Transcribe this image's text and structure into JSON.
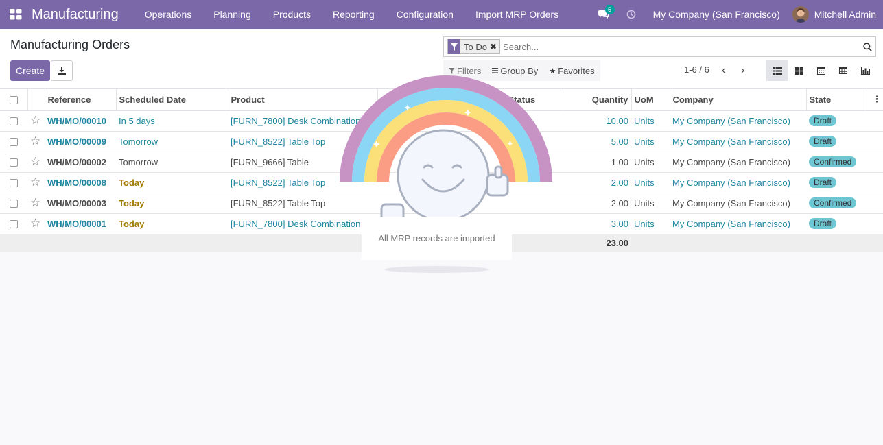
{
  "navbar": {
    "app_name": "Manufacturing",
    "menu": [
      "Operations",
      "Planning",
      "Products",
      "Reporting",
      "Configuration",
      "Import MRP Orders"
    ],
    "messages_count": "5",
    "company": "My Company (San Francisco)",
    "user": "Mitchell Admin",
    "color": "#7b68a8"
  },
  "control_panel": {
    "title": "Manufacturing Orders",
    "create_label": "Create",
    "search": {
      "facet": "To Do",
      "placeholder": "Search..."
    },
    "filters_label": "Filters",
    "group_by_label": "Group By",
    "favorites_label": "Favorites",
    "pager": "1-6 / 6"
  },
  "table": {
    "columns": [
      "Reference",
      "Scheduled Date",
      "Product",
      "Status",
      "Quantity",
      "UoM",
      "Company",
      "State"
    ],
    "rows": [
      {
        "reference": "WH/MO/00010",
        "date": "In 5 days",
        "product": "[FURN_7800] Desk Combination",
        "quantity": "10.00",
        "uom": "Units",
        "company": "My Company (San Francisco)",
        "state": "Draft"
      },
      {
        "reference": "WH/MO/00009",
        "date": "Tomorrow",
        "product": "[FURN_8522] Table Top",
        "quantity": "5.00",
        "uom": "Units",
        "company": "My Company (San Francisco)",
        "state": "Draft"
      },
      {
        "reference": "WH/MO/00002",
        "date": "Tomorrow",
        "product": "[FURN_9666] Table",
        "quantity": "1.00",
        "uom": "Units",
        "company": "My Company (San Francisco)",
        "state": "Confirmed"
      },
      {
        "reference": "WH/MO/00008",
        "date": "Today",
        "product": "[FURN_8522] Table Top",
        "quantity": "2.00",
        "uom": "Units",
        "company": "My Company (San Francisco)",
        "state": "Draft"
      },
      {
        "reference": "WH/MO/00003",
        "date": "Today",
        "product": "[FURN_8522] Table Top",
        "quantity": "2.00",
        "uom": "Units",
        "company": "My Company (San Francisco)",
        "state": "Confirmed"
      },
      {
        "reference": "WH/MO/00001",
        "date": "Today",
        "product": "[FURN_7800] Desk Combination",
        "quantity": "3.00",
        "uom": "Units",
        "company": "My Company (San Francisco)",
        "state": "Draft"
      }
    ],
    "total_quantity": "23.00"
  },
  "notification": {
    "message": "All MRP records are imported"
  }
}
